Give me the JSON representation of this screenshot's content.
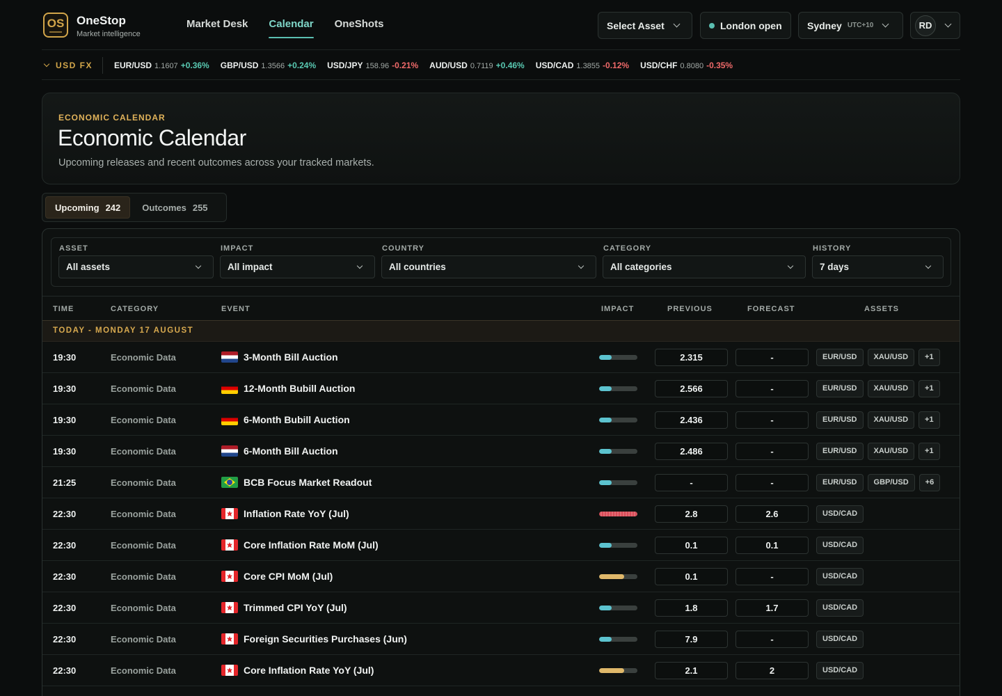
{
  "app": {
    "logo_text": "OS",
    "name": "OneStop",
    "tagline": "Market intelligence"
  },
  "nav": [
    {
      "label": "Market Desk",
      "active": false
    },
    {
      "label": "Calendar",
      "active": true
    },
    {
      "label": "OneShots",
      "active": false
    }
  ],
  "header": {
    "select_asset": "Select Asset",
    "session": "London open",
    "city": "Sydney",
    "utc": "UTC+10",
    "avatar": "RD"
  },
  "ticker": {
    "label": "USD FX",
    "items": [
      {
        "pair": "EUR/USD",
        "price": "1.1607",
        "change": "+0.36%",
        "dir": "pos"
      },
      {
        "pair": "GBP/USD",
        "price": "1.3566",
        "change": "+0.24%",
        "dir": "pos"
      },
      {
        "pair": "USD/JPY",
        "price": "158.96",
        "change": "-0.21%",
        "dir": "neg"
      },
      {
        "pair": "AUD/USD",
        "price": "0.7119",
        "change": "+0.46%",
        "dir": "pos"
      },
      {
        "pair": "USD/CAD",
        "price": "1.3855",
        "change": "-0.12%",
        "dir": "neg"
      },
      {
        "pair": "USD/CHF",
        "price": "0.8080",
        "change": "-0.35%",
        "dir": "neg"
      }
    ]
  },
  "hero": {
    "kicker": "ECONOMIC CALENDAR",
    "title": "Economic Calendar",
    "description": "Upcoming releases and recent outcomes across your tracked markets."
  },
  "tabs": [
    {
      "label": "Upcoming",
      "count": "242",
      "active": true
    },
    {
      "label": "Outcomes",
      "count": "255",
      "active": false
    }
  ],
  "filters": [
    {
      "label": "ASSET",
      "value": "All assets"
    },
    {
      "label": "IMPACT",
      "value": "All impact"
    },
    {
      "label": "COUNTRY",
      "value": "All countries"
    },
    {
      "label": "CATEGORY",
      "value": "All categories"
    },
    {
      "label": "HISTORY",
      "value": "7 days"
    }
  ],
  "columns": {
    "time": "TIME",
    "category": "CATEGORY",
    "event": "EVENT",
    "impact": "IMPACT",
    "previous": "PREVIOUS",
    "forecast": "FORECAST",
    "assets": "ASSETS"
  },
  "day_header": "TODAY - MONDAY 17 AUGUST",
  "rows": [
    {
      "time": "19:30",
      "category": "Economic Data",
      "flag": "nl",
      "event": "3-Month Bill Auction",
      "impact": "low",
      "impact_level": 0.33,
      "previous": "2.315",
      "forecast": "-",
      "assets": [
        "EUR/USD",
        "XAU/USD",
        "+1"
      ]
    },
    {
      "time": "19:30",
      "category": "Economic Data",
      "flag": "de",
      "event": "12-Month Bubill Auction",
      "impact": "low",
      "impact_level": 0.33,
      "previous": "2.566",
      "forecast": "-",
      "assets": [
        "EUR/USD",
        "XAU/USD",
        "+1"
      ]
    },
    {
      "time": "19:30",
      "category": "Economic Data",
      "flag": "de",
      "event": "6-Month Bubill Auction",
      "impact": "low",
      "impact_level": 0.33,
      "previous": "2.436",
      "forecast": "-",
      "assets": [
        "EUR/USD",
        "XAU/USD",
        "+1"
      ]
    },
    {
      "time": "19:30",
      "category": "Economic Data",
      "flag": "nl",
      "event": "6-Month Bill Auction",
      "impact": "low",
      "impact_level": 0.33,
      "previous": "2.486",
      "forecast": "-",
      "assets": [
        "EUR/USD",
        "XAU/USD",
        "+1"
      ]
    },
    {
      "time": "21:25",
      "category": "Economic Data",
      "flag": "br",
      "event": "BCB Focus Market Readout",
      "impact": "low",
      "impact_level": 0.33,
      "previous": "-",
      "forecast": "-",
      "assets": [
        "EUR/USD",
        "GBP/USD",
        "+6"
      ]
    },
    {
      "time": "22:30",
      "category": "Economic Data",
      "flag": "ca",
      "event": "Inflation Rate YoY (Jul)",
      "impact": "high",
      "impact_level": 1.0,
      "previous": "2.8",
      "forecast": "2.6",
      "assets": [
        "USD/CAD"
      ]
    },
    {
      "time": "22:30",
      "category": "Economic Data",
      "flag": "ca",
      "event": "Core Inflation Rate MoM (Jul)",
      "impact": "low",
      "impact_level": 0.33,
      "previous": "0.1",
      "forecast": "0.1",
      "assets": [
        "USD/CAD"
      ]
    },
    {
      "time": "22:30",
      "category": "Economic Data",
      "flag": "ca",
      "event": "Core CPI MoM (Jul)",
      "impact": "med",
      "impact_level": 0.66,
      "previous": "0.1",
      "forecast": "-",
      "assets": [
        "USD/CAD"
      ]
    },
    {
      "time": "22:30",
      "category": "Economic Data",
      "flag": "ca",
      "event": "Trimmed CPI YoY (Jul)",
      "impact": "low",
      "impact_level": 0.33,
      "previous": "1.8",
      "forecast": "1.7",
      "assets": [
        "USD/CAD"
      ]
    },
    {
      "time": "22:30",
      "category": "Economic Data",
      "flag": "ca",
      "event": "Foreign Securities Purchases (Jun)",
      "impact": "low",
      "impact_level": 0.33,
      "previous": "7.9",
      "forecast": "-",
      "assets": [
        "USD/CAD"
      ]
    },
    {
      "time": "22:30",
      "category": "Economic Data",
      "flag": "ca",
      "event": "Core Inflation Rate YoY (Jul)",
      "impact": "med",
      "impact_level": 0.66,
      "previous": "2.1",
      "forecast": "2",
      "assets": [
        "USD/CAD"
      ]
    }
  ],
  "colors": {
    "accent": "#5bbfb1",
    "gold": "#d3a64a",
    "positive": "#59c9b2",
    "negative": "#ef6a6a",
    "background": "#0b0d0d"
  }
}
